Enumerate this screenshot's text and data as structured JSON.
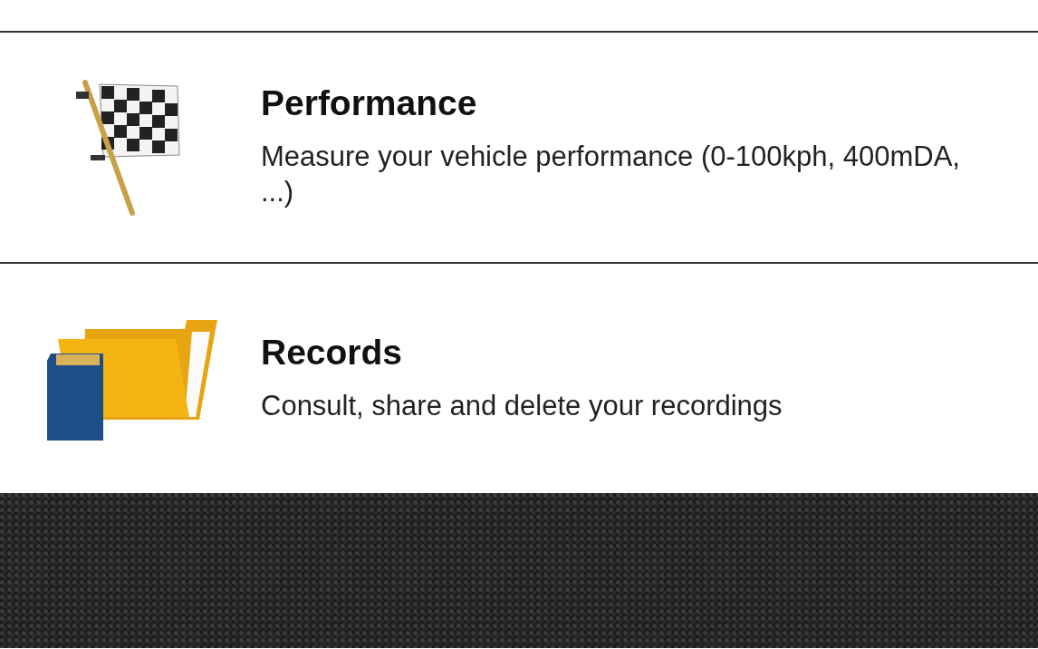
{
  "menu_items": [
    {
      "kind": "performance",
      "title": "Performance",
      "description": "Measure your vehicle performance (0-100kph, 400mDA, ...)"
    },
    {
      "kind": "records",
      "title": "Records",
      "description": "Consult, share and delete your recordings"
    }
  ]
}
